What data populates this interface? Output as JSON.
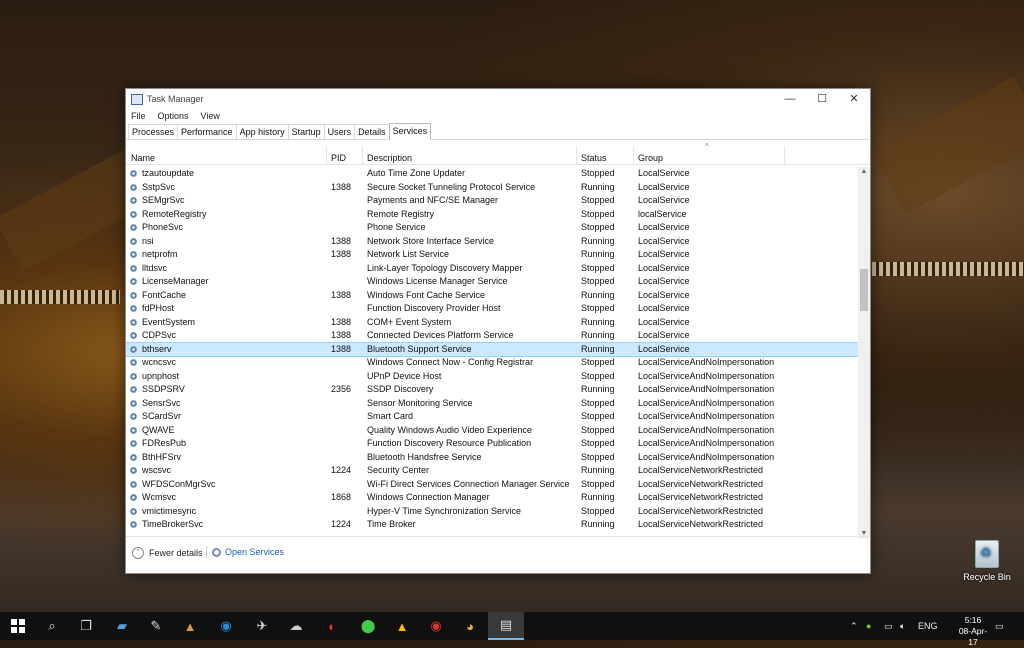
{
  "window": {
    "title": "Task Manager",
    "minimize": "—",
    "maximize": "☐",
    "close": "✕"
  },
  "menu": [
    "File",
    "Options",
    "View"
  ],
  "tabs": [
    "Processes",
    "Performance",
    "App history",
    "Startup",
    "Users",
    "Details",
    "Services"
  ],
  "active_tab": "Services",
  "columns": {
    "name": "Name",
    "pid": "PID",
    "description": "Description",
    "status": "Status",
    "group": "Group"
  },
  "rows": [
    {
      "name": "tzautoupdate",
      "pid": "",
      "description": "Auto Time Zone Updater",
      "status": "Stopped",
      "group": "LocalService"
    },
    {
      "name": "SstpSvc",
      "pid": "1388",
      "description": "Secure Socket Tunneling Protocol Service",
      "status": "Running",
      "group": "LocalService"
    },
    {
      "name": "SEMgrSvc",
      "pid": "",
      "description": "Payments and NFC/SE Manager",
      "status": "Stopped",
      "group": "LocalService"
    },
    {
      "name": "RemoteRegistry",
      "pid": "",
      "description": "Remote Registry",
      "status": "Stopped",
      "group": "localService"
    },
    {
      "name": "PhoneSvc",
      "pid": "",
      "description": "Phone Service",
      "status": "Stopped",
      "group": "LocalService"
    },
    {
      "name": "nsi",
      "pid": "1388",
      "description": "Network Store Interface Service",
      "status": "Running",
      "group": "LocalService"
    },
    {
      "name": "netprofm",
      "pid": "1388",
      "description": "Network List Service",
      "status": "Running",
      "group": "LocalService"
    },
    {
      "name": "lltdsvc",
      "pid": "",
      "description": "Link-Layer Topology Discovery Mapper",
      "status": "Stopped",
      "group": "LocalService"
    },
    {
      "name": "LicenseManager",
      "pid": "",
      "description": "Windows License Manager Service",
      "status": "Stopped",
      "group": "LocalService"
    },
    {
      "name": "FontCache",
      "pid": "1388",
      "description": "Windows Font Cache Service",
      "status": "Running",
      "group": "LocalService"
    },
    {
      "name": "fdPHost",
      "pid": "",
      "description": "Function Discovery Provider Host",
      "status": "Stopped",
      "group": "LocalService"
    },
    {
      "name": "EventSystem",
      "pid": "1388",
      "description": "COM+ Event System",
      "status": "Running",
      "group": "LocalService"
    },
    {
      "name": "CDPSvc",
      "pid": "1388",
      "description": "Connected Devices Platform Service",
      "status": "Running",
      "group": "LocalService"
    },
    {
      "name": "bthserv",
      "pid": "1388",
      "description": "Bluetooth Support Service",
      "status": "Running",
      "group": "LocalService"
    },
    {
      "name": "wcncsvc",
      "pid": "",
      "description": "Windows Connect Now - Config Registrar",
      "status": "Stopped",
      "group": "LocalServiceAndNoImpersonation"
    },
    {
      "name": "upnphost",
      "pid": "",
      "description": "UPnP Device Host",
      "status": "Stopped",
      "group": "LocalServiceAndNoImpersonation"
    },
    {
      "name": "SSDPSRV",
      "pid": "2356",
      "description": "SSDP Discovery",
      "status": "Running",
      "group": "LocalServiceAndNoImpersonation"
    },
    {
      "name": "SensrSvc",
      "pid": "",
      "description": "Sensor Monitoring Service",
      "status": "Stopped",
      "group": "LocalServiceAndNoImpersonation"
    },
    {
      "name": "SCardSvr",
      "pid": "",
      "description": "Smart Card",
      "status": "Stopped",
      "group": "LocalServiceAndNoImpersonation"
    },
    {
      "name": "QWAVE",
      "pid": "",
      "description": "Quality Windows Audio Video Experience",
      "status": "Stopped",
      "group": "LocalServiceAndNoImpersonation"
    },
    {
      "name": "FDResPub",
      "pid": "",
      "description": "Function Discovery Resource Publication",
      "status": "Stopped",
      "group": "LocalServiceAndNoImpersonation"
    },
    {
      "name": "BthHFSrv",
      "pid": "",
      "description": "Bluetooth Handsfree Service",
      "status": "Stopped",
      "group": "LocalServiceAndNoImpersonation"
    },
    {
      "name": "wscsvc",
      "pid": "1224",
      "description": "Security Center",
      "status": "Running",
      "group": "LocalServiceNetworkRestricted"
    },
    {
      "name": "WFDSConMgrSvc",
      "pid": "",
      "description": "Wi-Fi Direct Services Connection Manager Service",
      "status": "Stopped",
      "group": "LocalServiceNetworkRestricted"
    },
    {
      "name": "Wcmsvc",
      "pid": "1868",
      "description": "Windows Connection Manager",
      "status": "Running",
      "group": "LocalServiceNetworkRestricted"
    },
    {
      "name": "vmictimesync",
      "pid": "",
      "description": "Hyper-V Time Synchronization Service",
      "status": "Stopped",
      "group": "LocalServiceNetworkRestricted"
    },
    {
      "name": "TimeBrokerSvc",
      "pid": "1224",
      "description": "Time Broker",
      "status": "Running",
      "group": "LocalServiceNetworkRestricted"
    }
  ],
  "selected_row": "bthserv",
  "footer": {
    "fewer_details": "Fewer details",
    "open_services": "Open Services"
  },
  "desktop": {
    "recycle_bin": "Recycle Bin"
  },
  "taskbar": {
    "language": "ENG",
    "time": "5:16",
    "date": "08-Apr-17"
  },
  "colors": {
    "selection": "#cce8ff",
    "link": "#1a5fb4",
    "taskbar": "#101010"
  }
}
